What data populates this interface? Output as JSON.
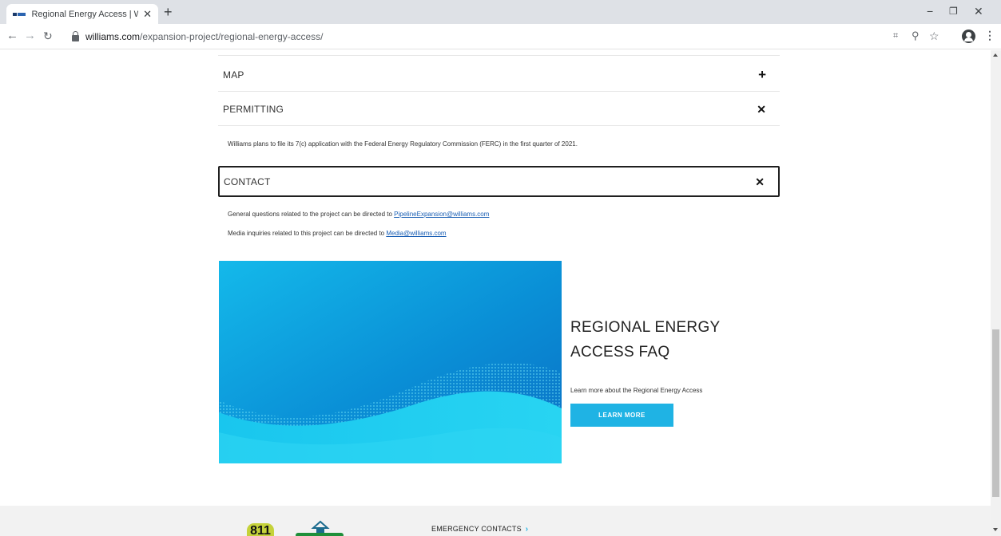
{
  "browser": {
    "tab_title": "Regional Energy Access | William",
    "tab_close": "✕",
    "new_tab": "+",
    "url_domain": "williams.com",
    "url_path": "/expansion-project/regional-energy-access/",
    "minimize": "−",
    "restore": "❐",
    "close": "✕"
  },
  "accordion": {
    "items": [
      {
        "label": "MAP",
        "icon": "+"
      },
      {
        "label": "PERMITTING",
        "icon": "✕"
      },
      {
        "label": "CONTACT",
        "icon": "✕"
      }
    ],
    "permitting_text": "Williams plans to file its 7(c) application with the Federal Energy Regulatory Commission (FERC) in the first quarter of 2021.",
    "contact_general_prefix": "General questions related to the project can be directed to ",
    "contact_general_email": "PipelineExpansion@williams.com",
    "contact_media_prefix": "Media inquiries related to this project can be directed to ",
    "contact_media_email": "Media@williams.com"
  },
  "promo": {
    "title": "REGIONAL ENERGY ACCESS FAQ",
    "description": "Learn more about the Regional Energy Access",
    "button_label": "LEARN MORE"
  },
  "footer": {
    "logo_811": "811",
    "emergency_contacts": "EMERGENCY CONTACTS"
  },
  "colors": {
    "accent": "#1fb3e4",
    "link": "#1a5fb4"
  }
}
